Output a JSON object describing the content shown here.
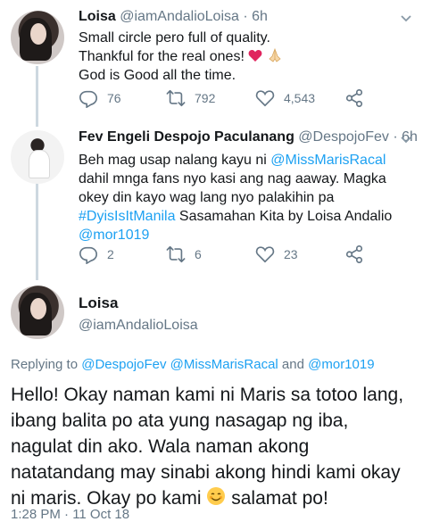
{
  "tweet1": {
    "name": "Loisa",
    "handle": "@iamAndalioLoisa",
    "separator": " · ",
    "time": "6h",
    "lines": [
      "Small circle pero full of quality.",
      "Thankful for the real ones!",
      "God is Good all the time."
    ],
    "emoji": [
      "heart",
      "praying-hands"
    ],
    "replies": "76",
    "retweets": "792",
    "likes": "4,543"
  },
  "tweet2": {
    "name": "Fev Engeli Despojo Paculanang",
    "handle": "@DespojoFev",
    "separator": " · ",
    "time": "6h",
    "text_a": "Beh mag usap nalang kayu ni ",
    "mention1": "@MissMarisRacal",
    "text_b": "  dahil mnga fans nyo kasi ang nag aaway. Magka okey din kayo wag lang nyo palakihin pa",
    "hashtag": "#DyisIsItManila",
    "text_c": " Sasamahan Kita by Loisa Andalio",
    "mention2": "@mor1019",
    "replies": "2",
    "retweets": "6",
    "likes": "23"
  },
  "main": {
    "name": "Loisa",
    "handle": "@iamAndalioLoisa",
    "replying_prefix": "Replying to ",
    "reply_to_1": "@DespojoFev",
    "reply_to_2": "@MissMarisRacal",
    "and_word": " and ",
    "reply_to_3": "@mor1019",
    "text_a": "Hello! Okay naman kami ni Maris sa totoo lang, ibang balita po ata yung nasagap ng iba, nagulat din ako. Wala naman akong natatandang may sinabi akong hindi kami okay ni maris. Okay po kami ",
    "text_b": " salamat po!",
    "emoji": "smiling-face",
    "timestamp": "1:28 PM · 11 Oct 18"
  },
  "colors": {
    "link": "#1da1f2",
    "muted": "#657786",
    "heart": "#e0245e"
  }
}
